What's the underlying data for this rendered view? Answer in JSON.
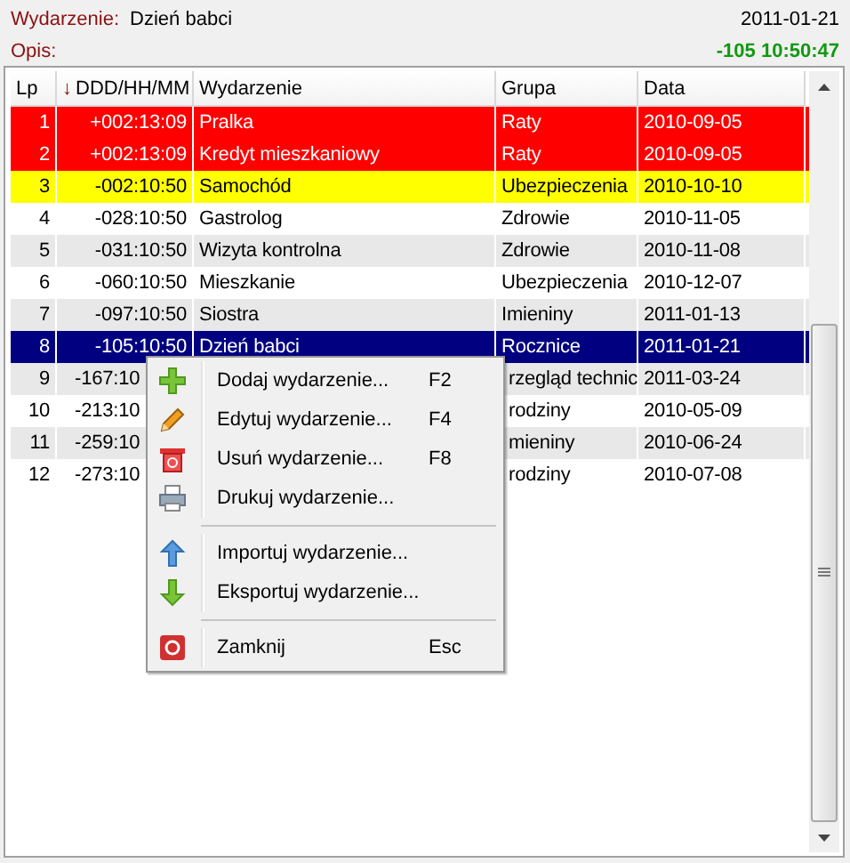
{
  "header": {
    "event_label": "Wydarzenie:",
    "event_value": "Dzień babci",
    "description_label": "Opis:",
    "date": "2011-01-21",
    "countdown": "-105 10:50:47"
  },
  "table": {
    "columns": [
      {
        "label": "Lp"
      },
      {
        "label": "DDD/HH/MM",
        "sort_indicator": "↓"
      },
      {
        "label": "Wydarzenie"
      },
      {
        "label": "Grupa"
      },
      {
        "label": "Data"
      }
    ],
    "rows": [
      {
        "lp": "1",
        "time": "+002:13:09",
        "event": "Pralka",
        "group": "Raty",
        "date": "2010-09-05",
        "color": "#ff0000",
        "selected": false,
        "covered": false
      },
      {
        "lp": "2",
        "time": "+002:13:09",
        "event": "Kredyt mieszkaniowy",
        "group": "Raty",
        "date": "2010-09-05",
        "color": "#ff0000",
        "selected": false,
        "covered": false
      },
      {
        "lp": "3",
        "time": "-002:10:50",
        "event": "Samochód",
        "group": "Ubezpieczenia",
        "date": "2010-10-10",
        "color": "#ffff00",
        "selected": false,
        "covered": false
      },
      {
        "lp": "4",
        "time": "-028:10:50",
        "event": "Gastrolog",
        "group": "Zdrowie",
        "date": "2010-11-05",
        "selected": false,
        "covered": false
      },
      {
        "lp": "5",
        "time": "-031:10:50",
        "event": "Wizyta kontrolna",
        "group": "Zdrowie",
        "date": "2010-11-08",
        "selected": false,
        "covered": false
      },
      {
        "lp": "6",
        "time": "-060:10:50",
        "event": "Mieszkanie",
        "group": "Ubezpieczenia",
        "date": "2010-12-07",
        "selected": false,
        "covered": false
      },
      {
        "lp": "7",
        "time": "-097:10:50",
        "event": "Siostra",
        "group": "Imieniny",
        "date": "2011-01-13",
        "selected": false,
        "covered": false
      },
      {
        "lp": "8",
        "time": "-105:10:50",
        "event": "Dzień babci",
        "group": "Rocznice",
        "date": "2011-01-21",
        "selected": true,
        "covered": false
      },
      {
        "lp": "9",
        "time": "-167:10",
        "group": "rzegląd technic",
        "date": "2011-03-24",
        "selected": false,
        "covered": true
      },
      {
        "lp": "10",
        "time": "-213:10",
        "group": "rodziny",
        "date": "2010-05-09",
        "selected": false,
        "covered": true
      },
      {
        "lp": "11",
        "time": "-259:10",
        "group": "mieniny",
        "date": "2010-06-24",
        "selected": false,
        "covered": true
      },
      {
        "lp": "12",
        "time": "-273:10",
        "group": "rodziny",
        "date": "2010-07-08",
        "selected": false,
        "covered": true
      }
    ]
  },
  "context_menu": {
    "items": [
      {
        "kind": "item",
        "label": "Dodaj wydarzenie...",
        "shortcut": "F2"
      },
      {
        "kind": "item",
        "label": "Edytuj wydarzenie...",
        "shortcut": "F4"
      },
      {
        "kind": "item",
        "label": "Usuń wydarzenie...",
        "shortcut": "F8"
      },
      {
        "kind": "item",
        "label": "Drukuj wydarzenie..."
      },
      {
        "kind": "separator"
      },
      {
        "kind": "item",
        "label": "Importuj wydarzenie..."
      },
      {
        "kind": "item",
        "label": "Eksportuj wydarzenie..."
      },
      {
        "kind": "separator"
      },
      {
        "kind": "item",
        "label": "Zamknij",
        "shortcut": "Esc"
      }
    ]
  }
}
